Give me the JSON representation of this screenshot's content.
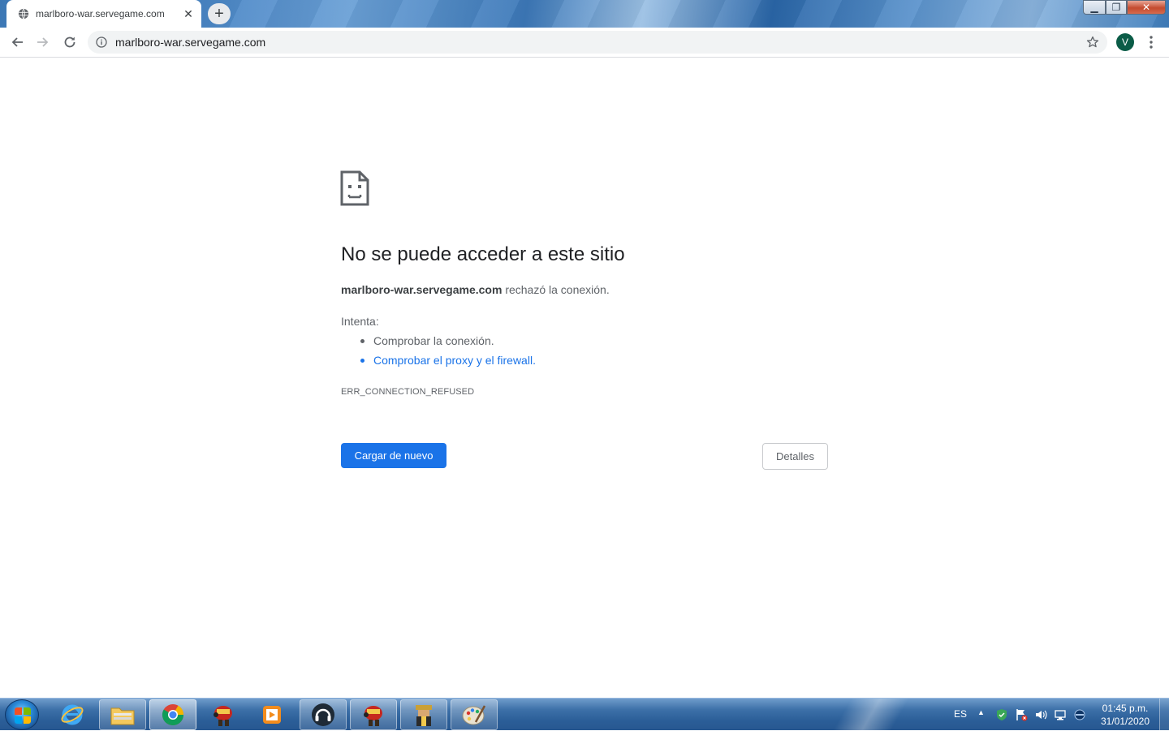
{
  "browser": {
    "tab": {
      "title": "marlboro-war.servegame.com",
      "close": "✕",
      "favicon": "globe-icon"
    },
    "new_tab": "+",
    "window_controls": {
      "minimize": "▁",
      "maximize": "❐",
      "close": "✕"
    },
    "omnibox": {
      "url": "marlboro-war.servegame.com",
      "info_icon": "info-icon",
      "star_icon": "star-icon"
    },
    "profile_initial": "V",
    "nav_icons": [
      "back-arrow-icon",
      "forward-arrow-icon",
      "reload-icon"
    ]
  },
  "error_page": {
    "title": "No se puede acceder a este sitio",
    "host": "marlboro-war.servegame.com",
    "message": "rechazó la conexión.",
    "try_label": "Intenta:",
    "suggestions": [
      {
        "text": "Comprobar la conexión.",
        "link": false
      },
      {
        "text": "Comprobar el proxy y el firewall.",
        "link": true
      }
    ],
    "error_code": "ERR_CONNECTION_REFUSED",
    "reload_button": "Cargar de nuevo",
    "details_button": "Detalles"
  },
  "taskbar": {
    "pinned": [
      "internet-explorer-icon",
      "file-explorer-icon",
      "chrome-icon",
      "game-app-icon",
      "media-player-icon",
      "headset-app-icon",
      "game-app-icon-2",
      "game-app-icon-3",
      "paint-icon"
    ],
    "language": "ES",
    "clock": {
      "time": "01:45 p.m.",
      "date": "31/01/2020"
    }
  },
  "colors": {
    "accent": "#1a73e8",
    "title_text": "#202124",
    "body_text": "#5f6368",
    "avatar": "#0b5c47"
  }
}
